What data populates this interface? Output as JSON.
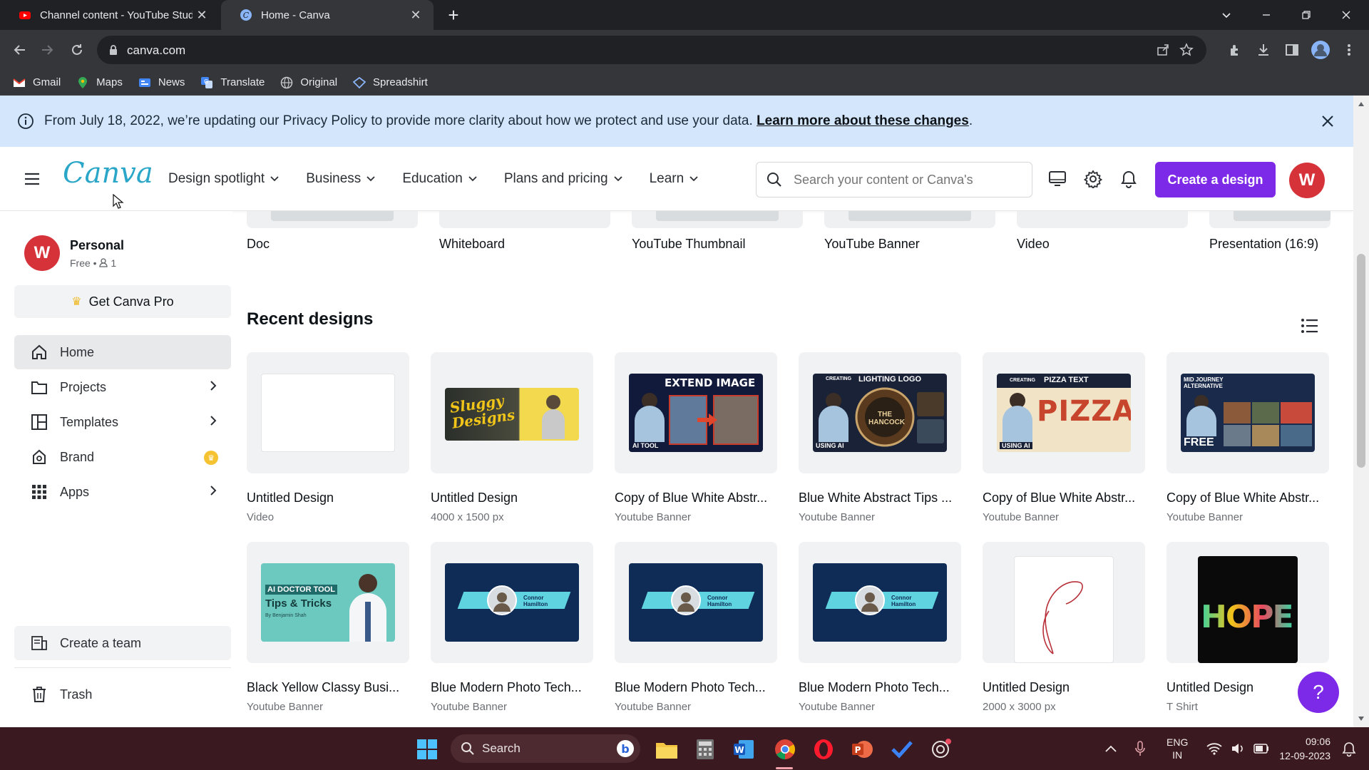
{
  "browser": {
    "tabs": [
      {
        "title": "Channel content - YouTube Studio",
        "active": false
      },
      {
        "title": "Home - Canva",
        "active": true
      }
    ],
    "url": "canva.com",
    "bookmarks": [
      "Gmail",
      "Maps",
      "News",
      "Translate",
      "Original",
      "Spreadshirt"
    ]
  },
  "banner": {
    "text": "From July 18, 2022, we’re updating our Privacy Policy to provide more clarity about how we protect and use your data.",
    "link": "Learn more about these changes"
  },
  "header": {
    "logo": "Canva",
    "nav": [
      "Design spotlight",
      "Business",
      "Education",
      "Plans and pricing",
      "Learn"
    ],
    "search_placeholder": "Search your content or Canva's",
    "create_label": "Create a design",
    "avatar_initial": "W",
    "brand_color": "#7d2ae8"
  },
  "sidebar": {
    "account_name": "Personal",
    "account_plan": "Free • ",
    "account_members": "1",
    "avatar_initial": "W",
    "pro_label": "Get Canva Pro",
    "items": [
      {
        "label": "Home",
        "icon": "home-icon"
      },
      {
        "label": "Projects",
        "icon": "folder-icon"
      },
      {
        "label": "Templates",
        "icon": "template-icon"
      },
      {
        "label": "Brand",
        "icon": "brand-icon"
      },
      {
        "label": "Apps",
        "icon": "apps-grid-icon"
      }
    ],
    "create_team": "Create a team",
    "trash": "Trash"
  },
  "design_types": [
    "Doc",
    "Whiteboard",
    "YouTube Thumbnail",
    "YouTube Banner",
    "Video",
    "Presentation (16:9)"
  ],
  "recent": {
    "title": "Recent designs",
    "row1": [
      {
        "title": "Untitled Design",
        "sub": "Video"
      },
      {
        "title": "Untitled Design",
        "sub": "4000 x 1500 px"
      },
      {
        "title": "Copy of Blue White Abstr...",
        "sub": "Youtube Banner"
      },
      {
        "title": "Blue White Abstract Tips ...",
        "sub": "Youtube Banner"
      },
      {
        "title": "Copy of Blue White Abstr...",
        "sub": "Youtube Banner"
      },
      {
        "title": "Copy of Blue White Abstr...",
        "sub": "Youtube Banner"
      }
    ],
    "row2": [
      {
        "title": "Black Yellow Classy Busi...",
        "sub": "Youtube Banner"
      },
      {
        "title": "Blue Modern Photo Tech...",
        "sub": "Youtube Banner"
      },
      {
        "title": "Blue Modern Photo Tech...",
        "sub": "Youtube Banner"
      },
      {
        "title": "Blue Modern Photo Tech...",
        "sub": "Youtube Banner"
      },
      {
        "title": "Untitled Design",
        "sub": "2000 x 3000 px"
      },
      {
        "title": "Untitled Design",
        "sub": "T Shirt"
      }
    ]
  },
  "thumbs": {
    "sluggy": "Sluggy Designs",
    "extend": "EXTEND IMAGE",
    "ai_tool": "AI TOOL",
    "creating": "CREATING",
    "lighting_logo": "LIGHTING LOGO",
    "hancock": "THE HANCOCK",
    "using_ai": "USING AI",
    "pizza_text": "PIZZA TEXT",
    "pizza": "PIZZA",
    "mid_journey": "MID JOURNEY ALTERNATIVE",
    "free": "FREE",
    "ai_doctor": "AI DOCTOR TOOL",
    "tips_tricks": "Tips & Tricks",
    "by_author": "By Benjamin Shah",
    "connor": "Connor Hamilton",
    "hope": "HOPE"
  },
  "help_label": "?",
  "taskbar": {
    "search_label": "Search",
    "lang": "ENG",
    "region": "IN",
    "time": "09:06",
    "date": "12-09-2023"
  }
}
